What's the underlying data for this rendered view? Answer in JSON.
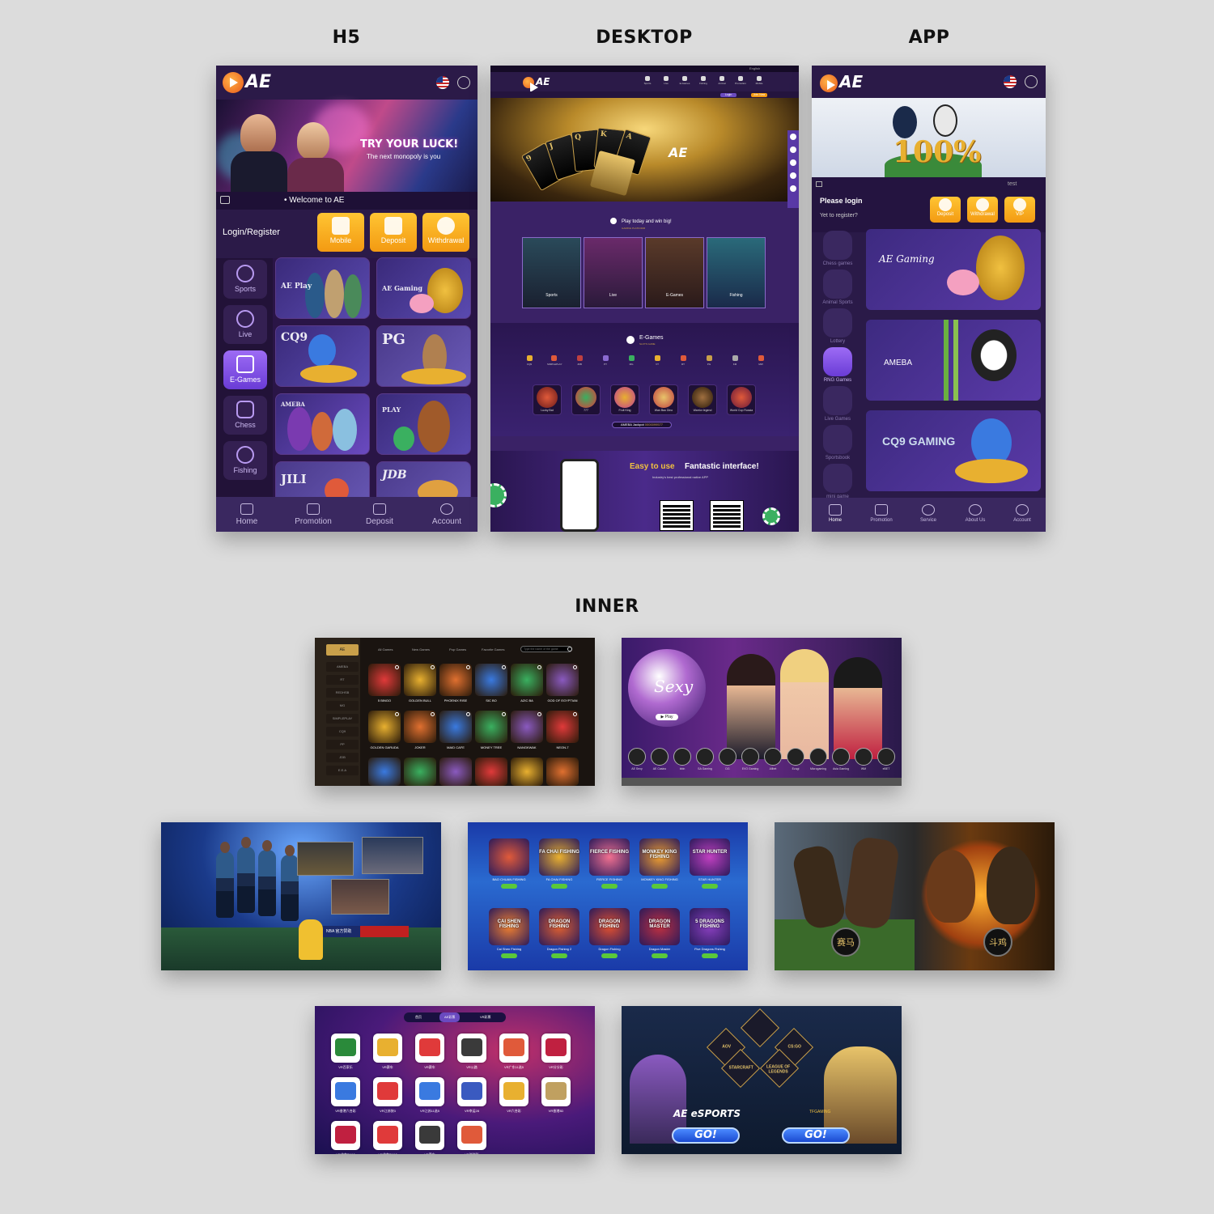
{
  "sections": {
    "h5": "H5",
    "desktop": "DESKTOP",
    "app": "APP",
    "inner": "INNER"
  },
  "brand": {
    "logo_text": "AE",
    "accent": "#f39a12",
    "purple": "#2a1546"
  },
  "h5": {
    "banner_title": "TRY YOUR LUCK!",
    "banner_sub": "The next monopoly is you",
    "welcome": "Welcome to AE",
    "login_register": "Login/Register",
    "buttons": [
      {
        "label": "Mobile",
        "icon": "mobile-icon"
      },
      {
        "label": "Deposit",
        "icon": "deposit-icon"
      },
      {
        "label": "Withdrawal",
        "icon": "piggy-bank-icon"
      }
    ],
    "side": [
      {
        "label": "Sports",
        "icon": "soccer-ball-icon"
      },
      {
        "label": "Live",
        "icon": "live-icon"
      },
      {
        "label": "E-Games",
        "icon": "slot-777-icon",
        "active": true
      },
      {
        "label": "Chess",
        "icon": "chess-icon"
      },
      {
        "label": "Fishing",
        "icon": "fish-icon"
      }
    ],
    "tiles": [
      "AE Play",
      "AE Gaming",
      "CQ9",
      "PG",
      "AMEBA",
      "PLAY",
      "JILI",
      "JDB"
    ],
    "nav": [
      {
        "label": "Home",
        "icon": "home-icon"
      },
      {
        "label": "Promotion",
        "icon": "gift-icon"
      },
      {
        "label": "Deposit",
        "icon": "deposit-icon"
      },
      {
        "label": "Account",
        "icon": "account-icon"
      }
    ]
  },
  "desktop": {
    "lang": "English",
    "nav": [
      "Sports",
      "Live",
      "E-Games",
      "Fishing",
      "Animal",
      "Promotion",
      "Mobile"
    ],
    "login": "Login",
    "join": "Join Now",
    "play_today": "Play today and win big!",
    "play_sub": "GAMING PLATFORM",
    "tiles": [
      {
        "label": "Sports",
        "sub": "SPORTS"
      },
      {
        "label": "Live",
        "sub": "CASINO"
      },
      {
        "label": "E-Games",
        "sub": "SLOTS GAME"
      },
      {
        "label": "Fishing",
        "sub": "FISHING"
      }
    ],
    "egames_title": "E-Games",
    "egames_sub": "SLOTS GAME",
    "providers": [
      "CQ9",
      "SIMPLEPLAY",
      "JDB",
      "PT",
      "MG",
      "VT",
      "RT",
      "PG",
      "KM",
      "MW"
    ],
    "games": [
      "Lucky Bat",
      "777",
      "Fruit King",
      "Wan Bao Dino",
      "Warrior legend",
      "World Cup Russia"
    ],
    "jackpot_label": "AMEBA Jackpot",
    "jackpot_value": "0000099577",
    "easy_title_1": "Easy to use",
    "easy_title_2": "Fantastic interface!",
    "easy_sub": "Industry's best professional native APP"
  },
  "app": {
    "banner_text": "100%",
    "test": "test",
    "please_login": "Please login",
    "yet_register": "Yet to register?",
    "buttons": [
      {
        "label": "Deposit",
        "icon": "dollar-icon"
      },
      {
        "label": "Withdrawal",
        "icon": "coin-icon"
      },
      {
        "label": "VIP",
        "icon": "crown-icon"
      }
    ],
    "side": [
      {
        "label": "Chess games"
      },
      {
        "label": "Animal Sports"
      },
      {
        "label": "Lottery"
      },
      {
        "label": "RNG Games",
        "active": true
      },
      {
        "label": "Live Games"
      },
      {
        "label": "Sportsbook"
      },
      {
        "label": "mini game"
      }
    ],
    "tiles": [
      "AE Gaming",
      "AMEBA",
      "CQ9 GAMING"
    ],
    "nav": [
      "Home",
      "Promotion",
      "Service",
      "About Us",
      "Account"
    ]
  },
  "inner1": {
    "selected": "AE",
    "left": [
      "AMEBA",
      "RT",
      "REDHSB",
      "MG",
      "SIMPLEPLAY",
      "CQ9",
      "PP",
      "JDB",
      "E.E.A"
    ],
    "tabs": [
      "All Games",
      "New Games",
      "Pop Games",
      "Favorite Games"
    ],
    "search_placeholder": "Type the name of the game",
    "row1": [
      "5 BINGO",
      "GOLDEN BULL",
      "PHOENIX RISE",
      "SIC BO",
      "AZIC BA",
      "GOD OF EGYPTIAN"
    ],
    "row2": [
      "GOLDEN GARUDA",
      "JOKER",
      "MAID CAFE",
      "MONEY TREE",
      "NANGKWAK",
      "NEON-7"
    ]
  },
  "inner2": {
    "brand": "Sexy",
    "play": "Play",
    "providers": [
      "AE Sexy",
      "AE Casino",
      "bbin",
      "SA Gaming",
      "DG",
      "EVO Gaming",
      "Allbet",
      "Ezugi",
      "Microgaming",
      "Asia Gaming",
      "WM",
      "eBET"
    ]
  },
  "inner3": {
    "nba": "NBA 官方赞助"
  },
  "inner4": {
    "row1": [
      "BAO CHUAN FISHING",
      "FA CHAI FISHING",
      "FIERCE FISHING",
      "MONKEY KING FISHING",
      "STAR HUNTER"
    ],
    "row2": [
      "Cai Shen Fishing",
      "Dragon Fishing 2",
      "Dragon Fishing",
      "Dragon Master",
      "Five Dragons Fishing"
    ],
    "row1_art": [
      "",
      "FA CHAI FISHING",
      "FIERCE FISHING",
      "MONKEY KING FISHING",
      "STAR HUNTER"
    ],
    "row2_art": [
      "CAI SHEN FISHING",
      "DRAGON FISHING",
      "DRAGON FISHING",
      "DRAGON MASTER",
      "5 DRAGONS FISHING"
    ]
  },
  "inner5": {
    "left": "赛马",
    "right": "斗鸡"
  },
  "inner6": {
    "tabs": [
      "首页",
      "AE彩票",
      "VR彩票"
    ],
    "items": [
      "VR百家乐",
      "VR赛车",
      "VR赛车",
      "VR公路",
      "VR广东11选5",
      "VR分分彩",
      "VR香港六合彩",
      "VR江苏快3",
      "VR江苏11选5",
      "VR幸运28",
      "VR六合彩",
      "VR香港3D",
      "VR北京PK10",
      "VR北京PK10",
      "VR赛车",
      "VR时时彩"
    ]
  },
  "inner7": {
    "games": [
      "AOV",
      "",
      "CS:GO",
      "STARCRAFT",
      "LEAGUE OF LEGENDS"
    ],
    "left_brand": "AE eSPORTS",
    "right_brand": "TFGAMING",
    "go": "GO!"
  }
}
